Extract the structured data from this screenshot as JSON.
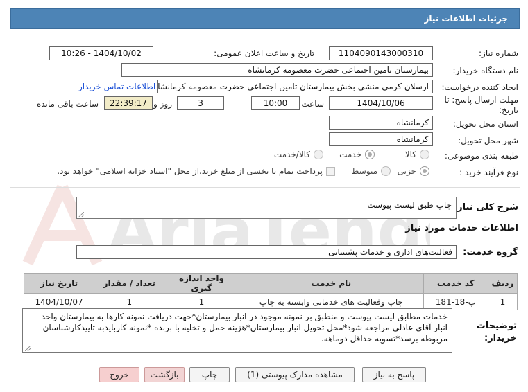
{
  "header": {
    "title": "جزئیات اطلاعات نیاز"
  },
  "need_number": {
    "label": "شماره نیاز:",
    "value": "1104090143000310"
  },
  "announce": {
    "label": "تاریخ و ساعت اعلان عمومی:",
    "value": "1404/10/02 - 10:26"
  },
  "buyer": {
    "label": "نام دستگاه خریدار:",
    "value": "بیمارستان تامین اجتماعی حضرت معصومه کرمانشاه"
  },
  "requester": {
    "label": "ایجاد کننده درخواست:",
    "value": "ارسلان کرمی منشی بخش  بیمارستان تامین اجتماعی حضرت معصومه کرمانشاه",
    "contact_link": "اطلاعات تماس خریدار"
  },
  "deadline": {
    "label_line1": "مهلت ارسال پاسخ: تا",
    "label_line2": "تاریخ:",
    "date": "1404/10/06",
    "time_label": "ساعت",
    "time": "10:00",
    "days": "3",
    "days_label": "روز و",
    "remaining": "22:39:17",
    "remaining_label": "ساعت باقی مانده"
  },
  "province": {
    "label": "استان محل تحویل:",
    "value": "کرمانشاه"
  },
  "city": {
    "label": "شهر محل تحویل:",
    "value": "کرمانشاه"
  },
  "category": {
    "label": "طبقه بندی موضوعی:",
    "options": [
      "کالا",
      "خدمت",
      "کالا/خدمت"
    ],
    "selected": "خدمت"
  },
  "purchase": {
    "label": "نوع فرآیند خرید :",
    "options": [
      "جزیی",
      "متوسط"
    ],
    "selected": "جزیی",
    "note": "پرداخت تمام یا بخشی از مبلغ خرید،از محل \"اسناد خزانه اسلامی\" خواهد بود."
  },
  "summary": {
    "label": "شرح کلی نیاز:",
    "value": "چاپ طبق لیست پیوست"
  },
  "services_title": "اطلاعات خدمات مورد نیاز",
  "service_group": {
    "label": "گروه خدمت:",
    "value": "فعالیت‌های اداری و خدمات پشتیبانی"
  },
  "table": {
    "headers": [
      "ردیف",
      "کد خدمت",
      "نام خدمت",
      "واحد اندازه گیری",
      "تعداد / مقدار",
      "تاریخ نیاز"
    ],
    "rows": [
      [
        "1",
        "پ-18-181",
        "چاپ وفعالیت های خدماتی وابسته به چاپ",
        "1",
        "1",
        "1404/10/07"
      ]
    ]
  },
  "buyer_notes": {
    "label_line1": "توضیحات",
    "label_line2": "خریدار:",
    "text": "خدمات مطابق لیست پیوست و منطبق بر نمونه موجود در انبار بیمارستان*جهت دریافت نمونه کارها به بیمارستان واحد انبار آقای عادلی مراجعه شود*محل تحویل انبار بیمارستان*هزینه حمل و تخلیه با برنده *نمونه کاربایدبه تاییدکارشناسان مربوطه برسد*تسویه حداقل دوماهه."
  },
  "buttons": {
    "reply": "پاسخ به نیاز",
    "view_docs": "مشاهده مدارک پیوستی (1)",
    "print": "چاپ",
    "back": "بازگشت",
    "exit": "خروج"
  },
  "watermark": {
    "text": "AriaTender.neT"
  }
}
